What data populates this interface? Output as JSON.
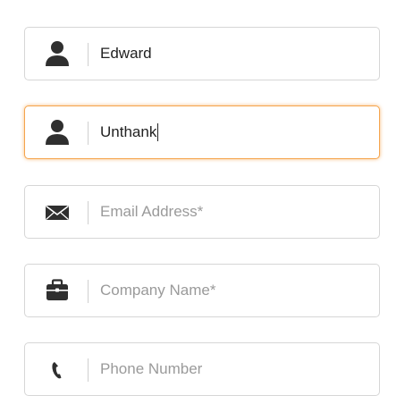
{
  "form": {
    "first_name": {
      "value": "Edward",
      "icon": "person-icon"
    },
    "last_name": {
      "value": "Unthank",
      "icon": "person-icon"
    },
    "email": {
      "placeholder": "Email Address*",
      "icon": "envelope-icon"
    },
    "company": {
      "placeholder": "Company Name*",
      "icon": "briefcase-icon"
    },
    "phone": {
      "placeholder": "Phone Number",
      "icon": "phone-icon"
    }
  },
  "colors": {
    "focus_border": "#f5a44c",
    "border": "#d6d6d6",
    "icon": "#2f2f2f",
    "placeholder": "#9a9a9a"
  }
}
